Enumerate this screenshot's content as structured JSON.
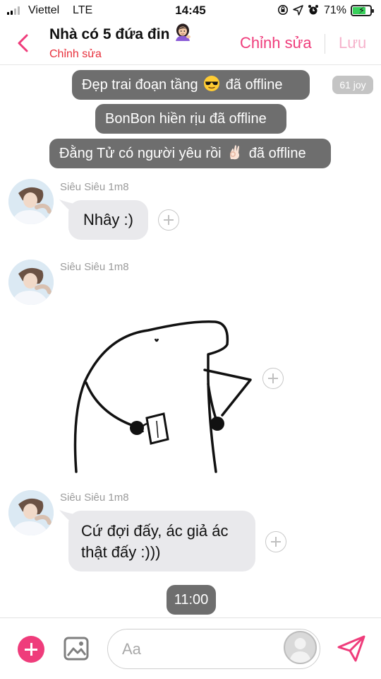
{
  "status_bar": {
    "carrier": "Viettel",
    "network": "LTE",
    "time": "14:45",
    "battery_percent": "71%",
    "battery_level": 0.71,
    "icons": [
      "lock-rotation-icon",
      "location-arrow-icon",
      "alarm-icon"
    ]
  },
  "header": {
    "title": "Nhà có 5 đứa đin",
    "title_emoji": "woman-tipping-hand-emoji",
    "subtitle": "Chỉnh sửa",
    "edit_label": "Chỉnh sửa",
    "save_label": "Lưu"
  },
  "notices": [
    {
      "text": "Đẹp trai đoạn tầng",
      "suffix": "đã offline",
      "emoji": "sunglasses-face-emoji"
    },
    {
      "text": "BonBon hiền rịu đã offline"
    },
    {
      "text": "Đằng Tử có người yêu rồi",
      "suffix": "đã offline",
      "emoji": "ok-hand-emoji"
    }
  ],
  "joy_badge": "61 joy",
  "messages": [
    {
      "sender": "Siêu Siêu 1m8",
      "text": "Nhây :)"
    },
    {
      "sender": "Siêu Siêu 1m8",
      "type": "sticker",
      "sticker": "blob-holding-cup-sticker"
    },
    {
      "sender": "Siêu Siêu 1m8",
      "lines": [
        "Cứ đợi đấy, ác giả ác",
        "thật đấy :)))"
      ]
    }
  ],
  "time_separator": "11:00",
  "composer": {
    "placeholder": "Aa"
  },
  "colors": {
    "accent": "#ef3c7b",
    "subtitle_red": "#e8303c",
    "notice_bg": "#6e6e6e",
    "bubble_bg": "#e9e9ec"
  }
}
